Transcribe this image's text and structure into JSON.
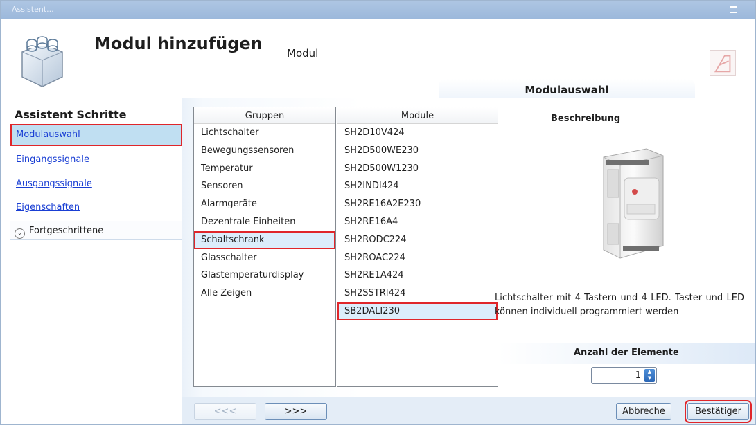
{
  "window": {
    "title": "Assistent..."
  },
  "header": {
    "title": "Modul hinzufügen",
    "subtitle": "Modul"
  },
  "section": {
    "title": "Modulauswahl"
  },
  "sidebar": {
    "heading": "Assistent Schritte",
    "items": [
      {
        "label": "Modulauswahl",
        "active": true
      },
      {
        "label": "Eingangssignale",
        "active": false
      },
      {
        "label": "Ausgangssignale",
        "active": false
      },
      {
        "label": "Eigenschaften",
        "active": false
      }
    ],
    "advanced": {
      "label": "Fortgeschrittene",
      "icon": "chevron-down-icon"
    }
  },
  "groups": {
    "header": "Gruppen",
    "items": [
      "Lichtschalter",
      "Bewegungssensoren",
      "Temperatur",
      "Sensoren",
      "Alarmgeräte",
      "Dezentrale Einheiten",
      "Schaltschrank",
      "Glasschalter",
      "Glastemperaturdisplay",
      "Alle Zeigen"
    ],
    "selected": "Schaltschrank"
  },
  "modules": {
    "header": "Module",
    "items": [
      "SH2D10V424",
      "SH2D500WE230",
      "SH2D500W1230",
      "SH2INDI424",
      "SH2RE16A2E230",
      "SH2RE16A4",
      "SH2RODC224",
      "SH2ROAC224",
      "SH2RE1A424",
      "SH2SSTRI424",
      "SB2DALI230"
    ],
    "selected": "SB2DALI230"
  },
  "description": {
    "heading": "Beschreibung",
    "text": "Lichtschalter mit 4 Tastern und 4 LED. Taster und LED können individuell programmiert werden"
  },
  "count": {
    "label": "Anzahl der Elemente",
    "value": "1"
  },
  "footer": {
    "prev_label": "<<<",
    "next_label": ">>>",
    "cancel_label": "Abbreche",
    "confirm_label": "Bestätiger"
  },
  "colors": {
    "accent": "#2a66b6",
    "highlight": "#e0262a",
    "link": "#1a3fd4",
    "selection": "#c0dff2"
  }
}
